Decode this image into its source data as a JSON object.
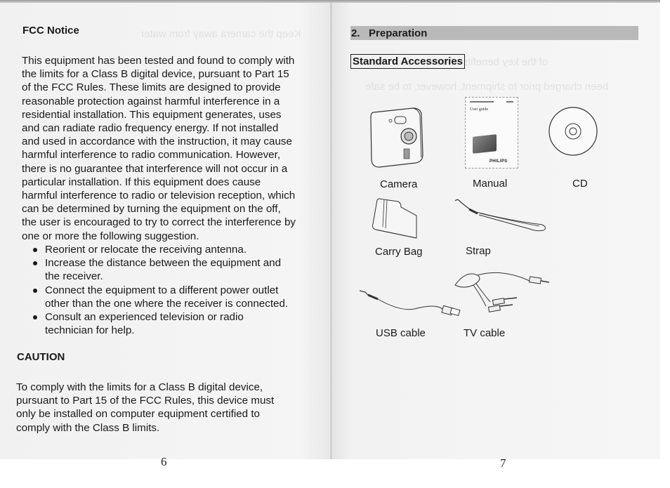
{
  "spread": {
    "left_page": {
      "heading": "FCC Notice",
      "paragraph_lines": [
        "This equipment has been tested and found to comply with",
        "the limits for a Class B digital device, pursuant to Part 15",
        "of the FCC Rules. These limits are designed to provide",
        "reasonable protection against harmful interference in a",
        "residential installation. This equipment generates, uses",
        "and can radiate radio frequency energy. If not installed",
        "and used in accordance with the instruction, it may cause",
        "harmful interference to radio communication. However,",
        "there is no guarantee that interference will not occur in a",
        "particular installation. If this equipment does cause",
        "harmful interference to radio or television reception, which",
        "can be determined by turning the equipment on the off,",
        "the user is encouraged to try to correct the interference by",
        "one or more the following suggestion."
      ],
      "suggestions": [
        {
          "lines": [
            "Reorient or relocate the receiving antenna."
          ]
        },
        {
          "lines": [
            "Increase the distance between the equipment and",
            "the receiver."
          ]
        },
        {
          "lines": [
            "Connect the equipment to a different power outlet",
            "other than the one where the receiver is connected."
          ]
        },
        {
          "lines": [
            "Consult an experienced television or radio",
            "technician for help."
          ]
        }
      ],
      "caution_heading": "CAUTION",
      "caution_lines": [
        "To comply with the limits for a Class B digital device,",
        "pursuant to Part 15 of the FCC Rules, this device must",
        "only be installed on computer equipment certified to",
        "comply with the Class B limits."
      ],
      "page_number": "6"
    },
    "right_page": {
      "section_title": "2.   Preparation",
      "subsection_title": "Standard Accessories",
      "accessories": [
        {
          "label": "Camera",
          "icon": "camera-icon"
        },
        {
          "label": "Manual",
          "icon": "manual-icon"
        },
        {
          "label": "CD",
          "icon": "cd-icon"
        },
        {
          "label": "Carry Bag",
          "icon": "carry-bag-icon"
        },
        {
          "label": "Strap",
          "icon": "strap-icon"
        },
        {
          "label": "USB cable",
          "icon": "usb-cable-icon"
        },
        {
          "label": "TV cable",
          "icon": "tv-cable-icon"
        }
      ],
      "manual_cover": {
        "title": "User guide",
        "brand": "PHILIPS"
      },
      "page_number": "7"
    }
  }
}
